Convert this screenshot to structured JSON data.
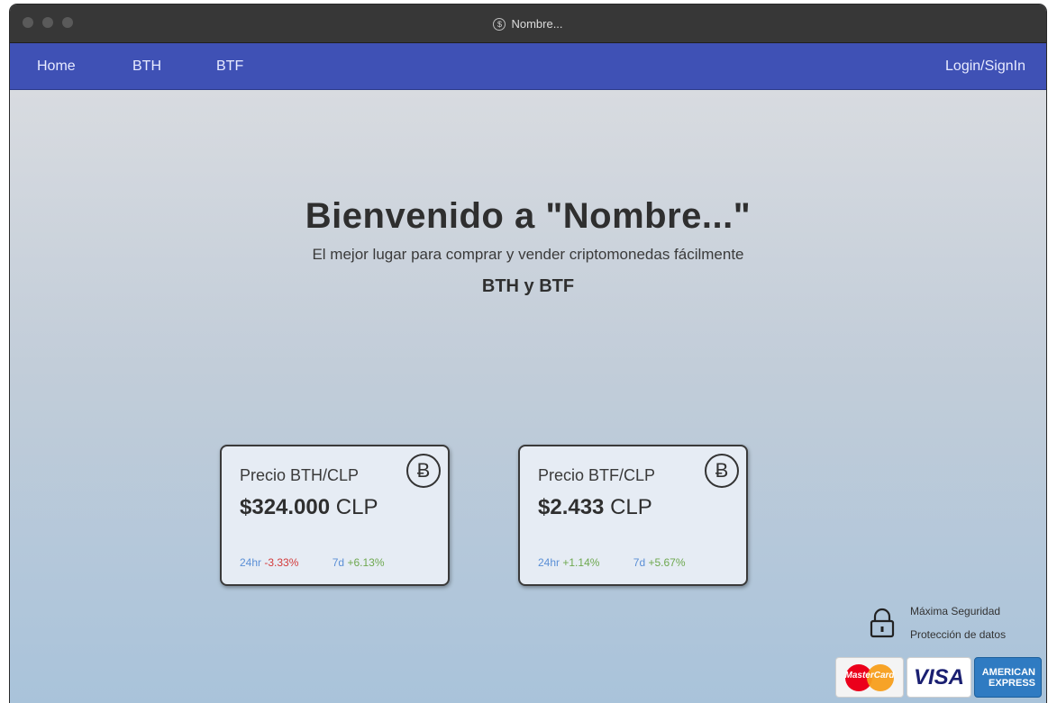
{
  "window": {
    "title": "Nombre...",
    "title_icon": "$"
  },
  "nav": {
    "home": "Home",
    "bth": "BTH",
    "btf": "BTF",
    "login": "Login/SignIn"
  },
  "hero": {
    "title": "Bienvenido a \"Nombre...\"",
    "subtitle": "El mejor lugar para comprar y vender criptomonedas fácilmente",
    "coins": "BTH y BTF"
  },
  "cards": [
    {
      "title": "Precio BTH/CLP",
      "amount": "$324.000",
      "currency": "CLP",
      "coin_symbol": "Ƀ",
      "h24_label": "24hr",
      "h24_value": "-3.33%",
      "d7_label": "7d",
      "d7_value": "+6.13%"
    },
    {
      "title": "Precio BTF/CLP",
      "amount": "$2.433",
      "currency": "CLP",
      "coin_symbol": "Ƀ",
      "h24_label": "24hr",
      "h24_value": "+1.14%",
      "d7_label": "7d",
      "d7_value": "+5.67%"
    }
  ],
  "security": {
    "line1": "Máxima Seguridad",
    "line2": "Protección de datos"
  },
  "payments": {
    "mastercard": "MasterCard",
    "visa": "VISA",
    "amex_line1": "AMERICAN",
    "amex_line2": "EXPRESS"
  },
  "colors": {
    "navbar": "#3f51b5",
    "negative": "#d33a3a",
    "positive": "#6ea84f",
    "label": "#5b8fd6"
  }
}
